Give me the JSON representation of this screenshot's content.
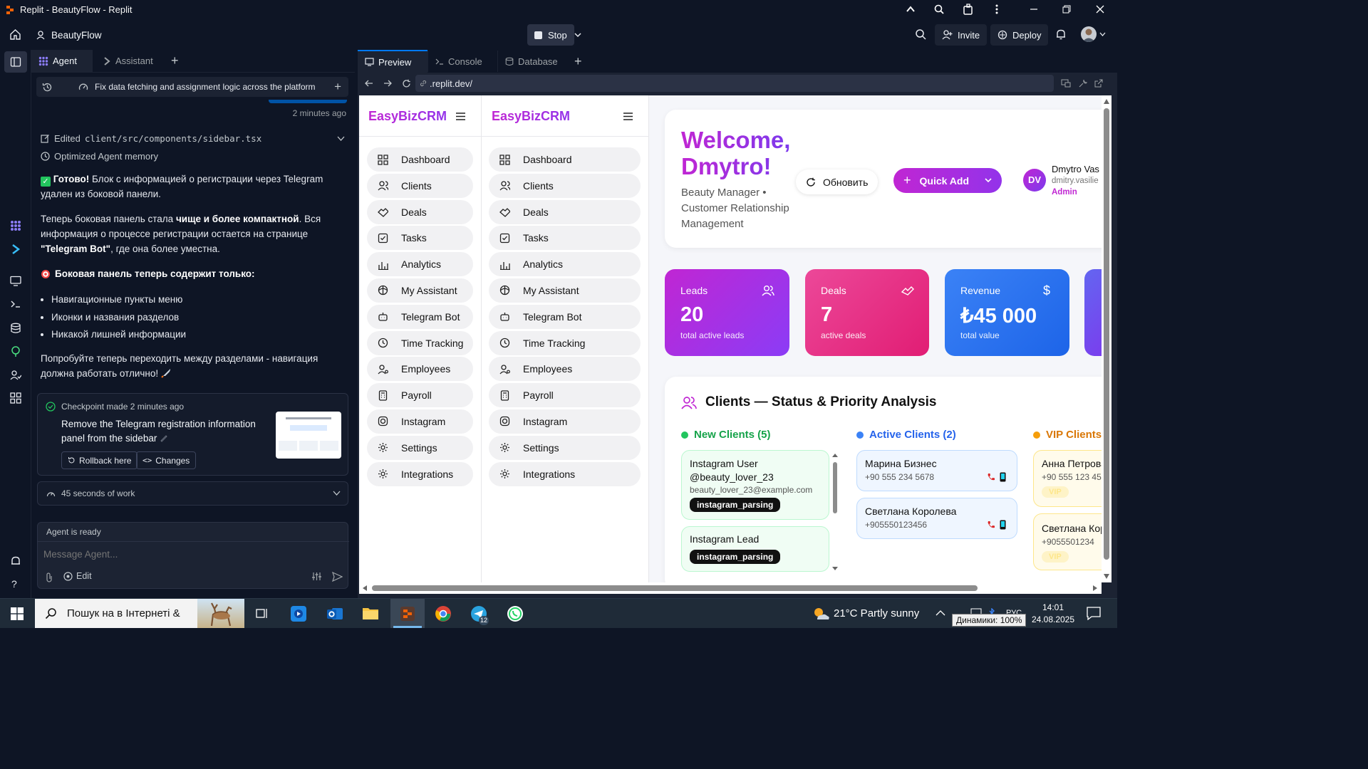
{
  "window": {
    "title": "Replit - BeautyFlow - Replit"
  },
  "topbar": {
    "project": "BeautyFlow",
    "stop": "Stop",
    "invite": "Invite",
    "deploy": "Deploy"
  },
  "agent_tabs": [
    {
      "label": "Agent"
    },
    {
      "label": "Assistant"
    }
  ],
  "preview_tabs": [
    {
      "label": "Preview"
    },
    {
      "label": "Console"
    },
    {
      "label": "Database"
    }
  ],
  "thread": {
    "title": "Fix data fetching and assignment logic across the platform"
  },
  "chat": {
    "timestamp": "2 minutes ago",
    "edited_label": "Edited",
    "edited_file": "client/src/components/sidebar.tsx",
    "memory": "Optimized Agent memory",
    "p1_bold": "Готово!",
    "p1_rest": " Блок с информацией о регистрации через Telegram удален из боковой панели.",
    "p2_a": "Теперь боковая панель стала ",
    "p2_b": "чище и более компактной",
    "p2_c": ". Вся информация о процессе регистрации остается на странице ",
    "p2_d": "\"Telegram Bot\"",
    "p2_e": ", где она более уместна.",
    "p3": "Боковая панель теперь содержит только:",
    "bullets": [
      "Навигационные пункты меню",
      "Иконки и названия разделов",
      "Никакой лишней информации"
    ],
    "p4": "Попробуйте теперь переходить между разделами - навигация должна работать отлично!"
  },
  "checkpoint": {
    "label": "Checkpoint made 2 minutes ago",
    "desc": "Remove the Telegram registration information panel from the sidebar",
    "rollback": "Rollback here",
    "changes": "Changes"
  },
  "work": {
    "label": "45 seconds of work"
  },
  "composer": {
    "status": "Agent is ready",
    "placeholder": "Message Agent...",
    "edit": "Edit"
  },
  "url": ".replit.dev/",
  "app": {
    "brand": "EasyBizCRM",
    "nav": [
      "Dashboard",
      "Clients",
      "Deals",
      "Tasks",
      "Analytics",
      "My Assistant",
      "Telegram Bot",
      "Time Tracking",
      "Employees",
      "Payroll",
      "Instagram",
      "Settings",
      "Integrations"
    ],
    "welcome_1": "Welcome,",
    "welcome_2": "Dmytro!",
    "subtitle": "Beauty Manager • Customer Relationship Management",
    "refresh": "Обновить",
    "quick_add": "Quick Add",
    "user": {
      "initials": "DV",
      "name": "Dmytro Vas",
      "email": "dmitry.vasilie",
      "role": "Admin"
    },
    "stats": [
      {
        "label": "Leads",
        "value": "20",
        "sub": "total active leads"
      },
      {
        "label": "Deals",
        "value": "7",
        "sub": "active deals"
      },
      {
        "label": "Revenue",
        "value": "₺45 000",
        "sub": "total value"
      }
    ],
    "clients_title": "Clients — Status & Priority Analysis",
    "columns": [
      {
        "title": "New Clients (5)",
        "color": "#22c55e"
      },
      {
        "title": "Active Clients (2)",
        "color": "#3b82f6"
      },
      {
        "title": "VIP Clients",
        "color": "#f59e0b"
      }
    ],
    "new_clients": [
      {
        "name": "Instagram User @beauty_lover_23",
        "email": "beauty_lover_23@example.com",
        "tag": "instagram_parsing"
      },
      {
        "name": "Instagram Lead",
        "tag": "instagram_parsing"
      }
    ],
    "active_clients": [
      {
        "name": "Марина Бизнес",
        "phone": "+90 555 234 5678"
      },
      {
        "name": "Светлана Королева",
        "phone": "+905550123456"
      }
    ],
    "vip_clients": [
      {
        "name": "Анна Петрова",
        "phone": "+90 555 123 45",
        "tag": "VIP"
      },
      {
        "name": "Светлана Кор",
        "phone": "+9055501234",
        "tag": "VIP"
      }
    ]
  },
  "taskbar": {
    "search": "Пошук на в Інтернеті &",
    "weather": "21°C Partly sunny",
    "volume": "Динамики: 100%",
    "lang": "РУС",
    "time": "14:01",
    "date": "24.08.2025",
    "telegram_badge": "12"
  }
}
